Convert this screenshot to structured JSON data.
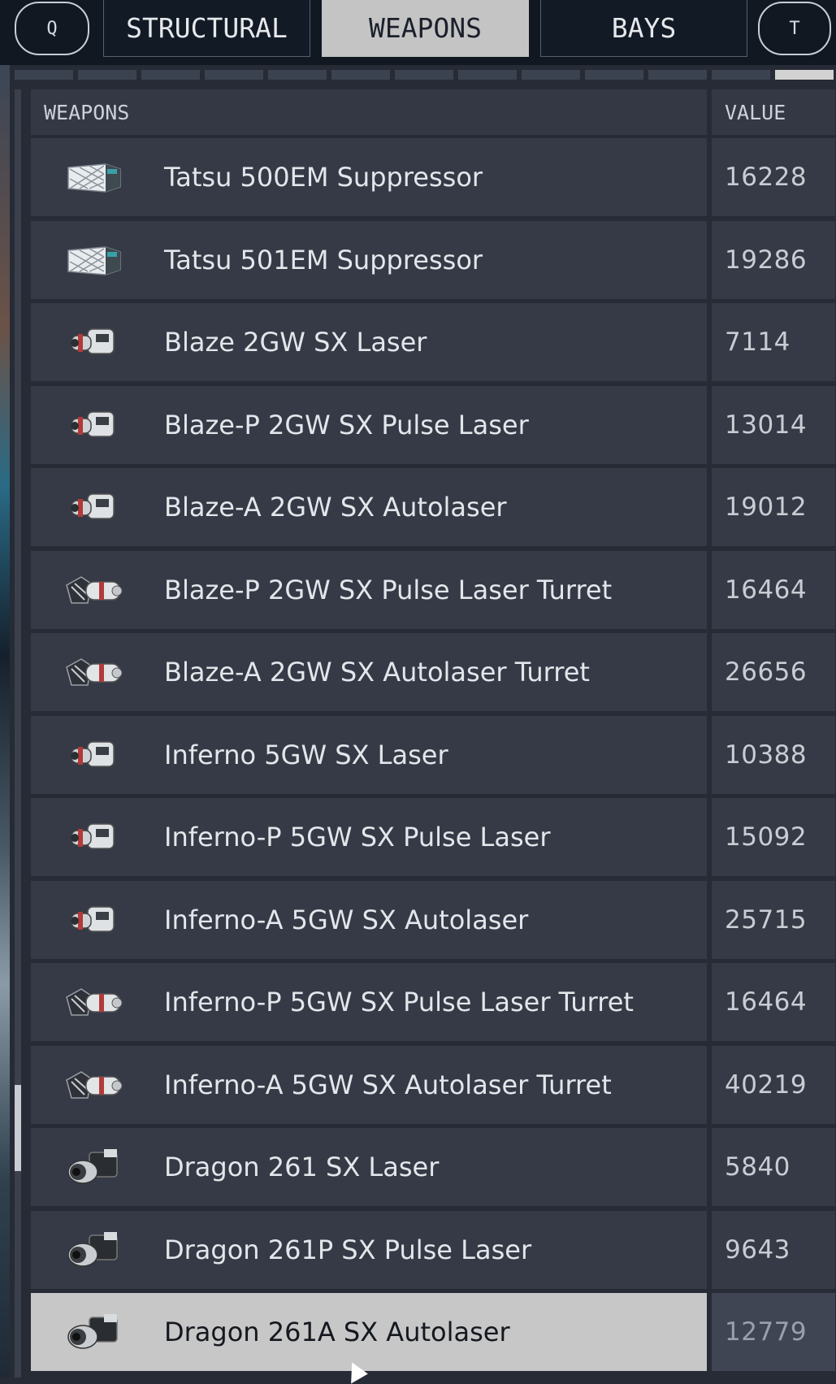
{
  "tabs": {
    "left_key": "Q",
    "right_key": "T",
    "items": [
      "STRUCTURAL",
      "WEAPONS",
      "BAYS"
    ],
    "active": "WEAPONS"
  },
  "list": {
    "header_name": "WEAPONS",
    "header_value": "VALUE",
    "rows": [
      {
        "name": "Tatsu 500EM Suppressor",
        "value": "16228",
        "icon": "suppressor-icon"
      },
      {
        "name": "Tatsu 501EM Suppressor",
        "value": "19286",
        "icon": "suppressor-icon"
      },
      {
        "name": "Blaze 2GW SX Laser",
        "value": "7114",
        "icon": "laser-icon"
      },
      {
        "name": "Blaze-P 2GW SX Pulse Laser",
        "value": "13014",
        "icon": "laser-icon"
      },
      {
        "name": "Blaze-A 2GW SX Autolaser",
        "value": "19012",
        "icon": "laser-icon"
      },
      {
        "name": "Blaze-P 2GW SX Pulse Laser Turret",
        "value": "16464",
        "icon": "turret-icon"
      },
      {
        "name": "Blaze-A 2GW SX Autolaser Turret",
        "value": "26656",
        "icon": "turret-icon"
      },
      {
        "name": "Inferno 5GW SX Laser",
        "value": "10388",
        "icon": "laser-icon"
      },
      {
        "name": "Inferno-P 5GW SX Pulse Laser",
        "value": "15092",
        "icon": "laser-icon"
      },
      {
        "name": "Inferno-A 5GW SX Autolaser",
        "value": "25715",
        "icon": "laser-icon"
      },
      {
        "name": "Inferno-P 5GW SX Pulse Laser Turret",
        "value": "16464",
        "icon": "turret-icon"
      },
      {
        "name": "Inferno-A 5GW SX Autolaser Turret",
        "value": "40219",
        "icon": "turret-icon"
      },
      {
        "name": "Dragon 261 SX Laser",
        "value": "5840",
        "icon": "dragon-laser-icon"
      },
      {
        "name": "Dragon 261P SX Pulse Laser",
        "value": "9643",
        "icon": "dragon-laser-icon"
      },
      {
        "name": "Dragon 261A SX Autolaser",
        "value": "12779",
        "icon": "dragon-laser-icon",
        "selected": true
      }
    ]
  },
  "progress_segments": {
    "total": 13,
    "filled": 1
  }
}
